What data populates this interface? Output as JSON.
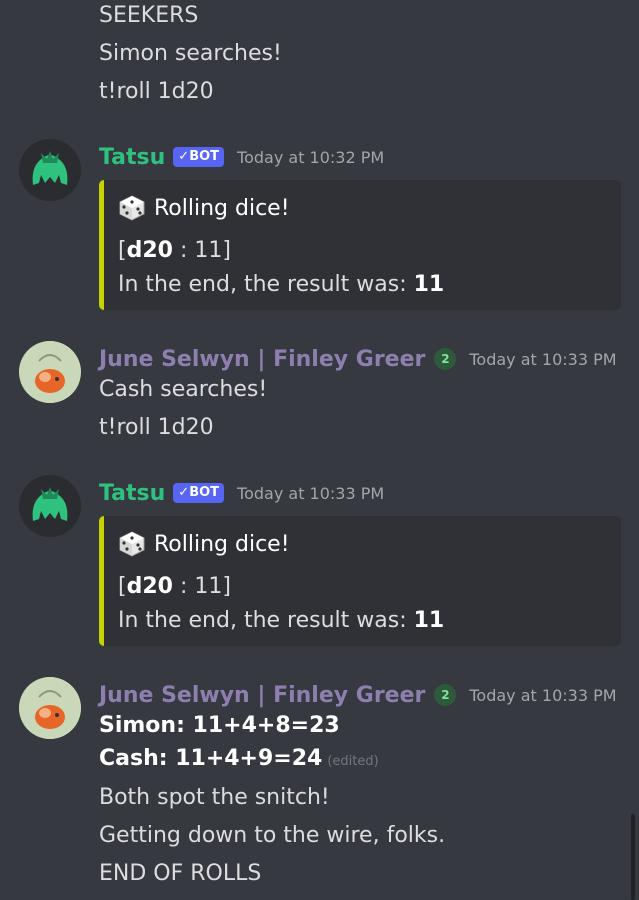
{
  "top_lines": [
    "SEEKERS",
    "Simon searches!",
    "t!roll 1d20"
  ],
  "messages": [
    {
      "author": "Tatsu",
      "bot_tag": "✓BOT",
      "timestamp": "Today at 10:32 PM",
      "embed": {
        "title": "Rolling dice!",
        "roll_prefix": "[",
        "roll_die": "d20",
        "roll_sep": " : ",
        "roll_value": "11",
        "roll_suffix": "]",
        "result_label": "In the end, the result was: ",
        "result_value": "11"
      }
    },
    {
      "author": "June Selwyn | Finley Greer",
      "role_badge": "2",
      "timestamp": "Today at 10:33 PM",
      "lines": [
        "Cash searches!",
        "t!roll 1d20"
      ]
    },
    {
      "author": "Tatsu",
      "bot_tag": "✓BOT",
      "timestamp": "Today at 10:33 PM",
      "embed": {
        "title": "Rolling dice!",
        "roll_prefix": "[",
        "roll_die": "d20",
        "roll_sep": " : ",
        "roll_value": "11",
        "roll_suffix": "]",
        "result_label": "In the end, the result was: ",
        "result_value": "11"
      }
    },
    {
      "author": "June Selwyn | Finley Greer",
      "role_badge": "2",
      "timestamp": "Today at 10:33 PM",
      "bold_lines": [
        "Simon: 11+4+8=23",
        "Cash: 11+4+9=24"
      ],
      "edited_label": "(edited)",
      "lines": [
        "Both spot the snitch!",
        "Getting down to the wire, folks.",
        "END OF ROLLS"
      ]
    }
  ],
  "colors": {
    "background": "#36393f",
    "embed_bg": "#2f3136",
    "embed_accent": "#c7d300",
    "tatsu_name": "#2ec27e",
    "june_name": "#8e7fb0",
    "bot_tag": "#5865f2"
  },
  "icons": {
    "dice": "game-die-icon",
    "role": "role-badge-icon"
  }
}
